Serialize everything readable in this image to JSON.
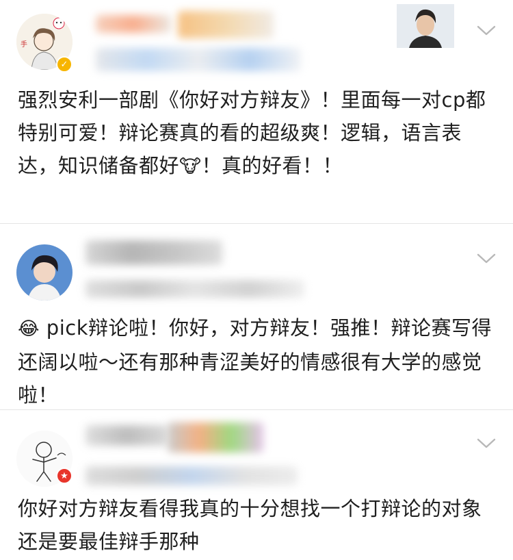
{
  "colors": {
    "text": "#1f1f1f",
    "divider": "#e4e4e4",
    "verified_badge": "#f7b500",
    "ticket_badge": "#e8352b",
    "chevron": "#b8b8b8"
  },
  "posts": [
    {
      "text": "强烈安利一部剧《你好对方辩友》！里面每一对cp都特别可爱！辩论赛真的看的超级爽！逻辑，语言表达，知识储备都好",
      "emoji": "🐮",
      "text_after": "！真的好看！！",
      "badge_icon": "verified-icon",
      "menu_icon": "chevron-down-icon",
      "avatar_label": "手"
    },
    {
      "emoji": "😂",
      "text": " pick辩论啦！你好，对方辩友！强推！辩论赛写得还阔以啦～还有那种青涩美好的情感很有大学的感觉啦！",
      "menu_icon": "chevron-down-icon"
    },
    {
      "text": "你好对方辩友看得我真的十分想找一个打辩论的对象 还是要最佳辩手那种",
      "badge_icon": "ticket-star-icon",
      "menu_icon": "chevron-down-icon"
    }
  ]
}
